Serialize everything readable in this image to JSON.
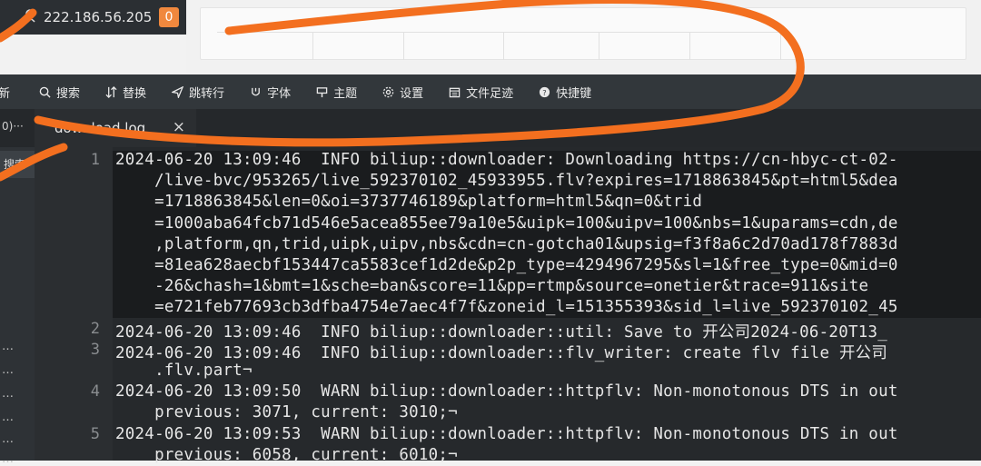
{
  "header": {
    "ip_address": "222.186.56.205",
    "badge_count": "0",
    "top_left_glyph": "武"
  },
  "toolbar": {
    "items": [
      {
        "label": "新",
        "icon": "refresh-icon"
      },
      {
        "label": "搜索",
        "icon": "search-icon"
      },
      {
        "label": "替换",
        "icon": "replace-icon"
      },
      {
        "label": "跳转行",
        "icon": "goto-line-icon"
      },
      {
        "label": "字体",
        "icon": "font-icon"
      },
      {
        "label": "主题",
        "icon": "theme-icon"
      },
      {
        "label": "设置",
        "icon": "gear-icon"
      },
      {
        "label": "文件足迹",
        "icon": "calendar-icon"
      },
      {
        "label": "快捷键",
        "icon": "help-icon"
      }
    ]
  },
  "sidebar": {
    "header_text": "0)···",
    "search_label": "搜索",
    "dots": [
      "…",
      "…",
      "…",
      "…",
      "…",
      "…"
    ]
  },
  "tab": {
    "filename": "download.log",
    "close_label": "×"
  },
  "editor": {
    "lines": [
      {
        "number": "1",
        "rows": [
          "2024-06-20 13:09:46  INFO biliup::downloader: Downloading https://cn-hbyc-ct-02-",
          "    /live-bvc/953265/live_592370102_45933955.flv?expires=1718863845&pt=html5&dea",
          "    =1718863845&len=0&oi=3737746189&platform=html5&qn=0&trid",
          "    =1000aba64fcb71d546e5acea855ee79a10e5&uipk=100&uipv=100&nbs=1&uparams=cdn,de",
          "    ,platform,qn,trid,uipk,uipv,nbs&cdn=cn-gotcha01&upsig=f3f8a6c2d70ad178f7883d",
          "    =81ea628aecbf153447ca5583cef1d2de&p2p_type=4294967295&sl=1&free_type=0&mid=0",
          "    -26&chash=1&bmt=1&sche=ban&score=11&pp=rtmp&source=onetier&trace=911&site",
          "    =e721feb77693cb3dfba4754e7aec4f7f&zoneid_l=151355393&sid_l=live_592370102_45"
        ]
      },
      {
        "number": "2",
        "rows": [
          "2024-06-20 13:09:46  INFO biliup::downloader::util: Save to 开公司2024-06-20T13_"
        ]
      },
      {
        "number": "3",
        "rows": [
          "2024-06-20 13:09:46  INFO biliup::downloader::flv_writer: create flv file 开公司",
          "    .flv.part¬"
        ]
      },
      {
        "number": "4",
        "rows": [
          "2024-06-20 13:09:50  WARN biliup::downloader::httpflv: Non-monotonous DTS in out",
          "    previous: 3071, current: 3010;¬"
        ]
      },
      {
        "number": "5",
        "rows": [
          "2024-06-20 13:09:53  WARN biliup::downloader::httpflv: Non-monotonous DTS in out",
          "    previous: 6058, current: 6010;¬"
        ]
      }
    ]
  },
  "colors": {
    "toolbar_bg": "#32373b",
    "editor_bg": "#26292c",
    "active_tab_underline": "#39c07a",
    "badge": "#f0883e",
    "annotation": "#f36f1f"
  }
}
